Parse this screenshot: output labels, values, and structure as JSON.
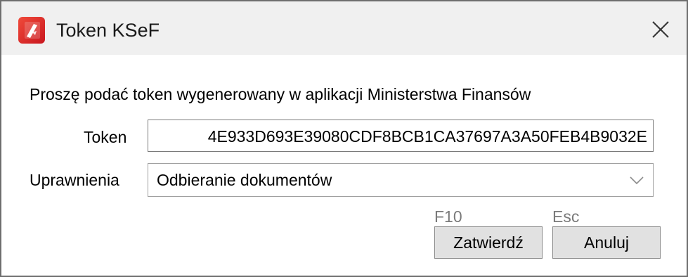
{
  "window": {
    "title": "Token KSeF",
    "close_glyph": "×"
  },
  "form": {
    "prompt": "Proszę podać token wygenerowany w aplikacji Ministerstwa Finansów",
    "token_label": "Token",
    "token_value": "4E933D693E39080CDF8BCB1CA37697A3A50FEB4B9032E",
    "permissions_label": "Uprawnienia",
    "permissions_value": "Odbieranie dokumentów"
  },
  "buttons": {
    "confirm_hotkey": "F10",
    "confirm_label": "Zatwierdź",
    "cancel_hotkey": "Esc",
    "cancel_label": "Anuluj"
  },
  "icons": {
    "app": "ksef-app-icon",
    "close": "close-icon",
    "dropdown": "chevron-down-icon"
  },
  "colors": {
    "titlebar_bg": "#f0f0f0",
    "app_icon_red": "#e0282a",
    "button_bg": "#e1e1e1",
    "hotkey_text": "#7a7a7a"
  }
}
